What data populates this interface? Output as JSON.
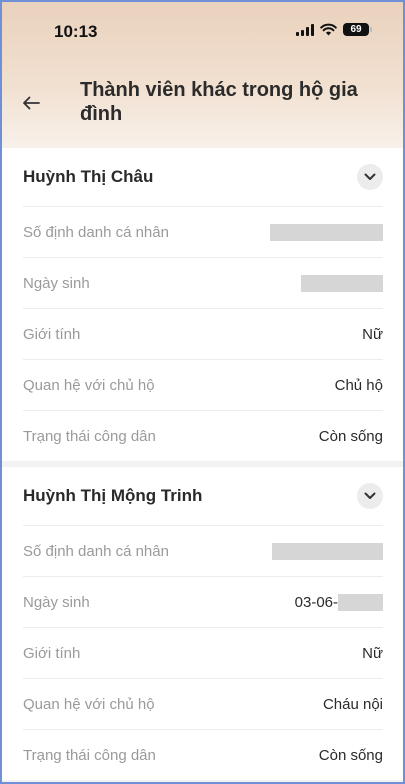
{
  "status_bar": {
    "time": "10:13",
    "battery": "69"
  },
  "header": {
    "title": "Thành viên khác trong hộ gia đình"
  },
  "members": [
    {
      "name": "Huỳnh Thị Châu",
      "fields": [
        {
          "label": "Số định danh cá nhân",
          "value": ""
        },
        {
          "label": "Ngày sinh",
          "value": ""
        },
        {
          "label": "Giới tính",
          "value": "Nữ"
        },
        {
          "label": "Quan hệ với chủ hộ",
          "value": "Chủ hộ"
        },
        {
          "label": "Trạng thái công dân",
          "value": "Còn sống"
        }
      ]
    },
    {
      "name": "Huỳnh Thị Mộng Trinh",
      "fields": [
        {
          "label": "Số định danh cá nhân",
          "value": ""
        },
        {
          "label": "Ngày sinh",
          "value": "03-06-"
        },
        {
          "label": "Giới tính",
          "value": "Nữ"
        },
        {
          "label": "Quan hệ với chủ hộ",
          "value": "Cháu nội"
        },
        {
          "label": "Trạng thái công dân",
          "value": "Còn sống"
        }
      ]
    }
  ]
}
